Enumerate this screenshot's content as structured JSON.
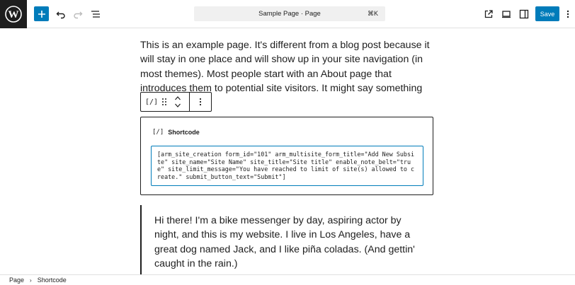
{
  "toolbar": {
    "command_title": "Sample Page · Page",
    "command_shortcut": "⌘K",
    "save_label": "Save"
  },
  "content": {
    "paragraph": "This is an example page. It's different from a blog post because it will stay in one place and will show up in your site navigation (in most themes). Most people start with an About page that introduces them to potential site visitors. It might say something",
    "shortcode_block": {
      "label": "Shortcode",
      "icon_text": "[/]",
      "value": "[arm_site_creation form_id=\"101\" arm_multisite_form_title=\"Add New Subsite\" site_name=\"Site Name\" site_title=\"Site title\" enable_note_belt=\"true\" site_limit_message=\"You have reached to limit of site(s) allowed to create.\" submit_button_text=\"Submit\"]"
    },
    "block_toolbar": {
      "icon_text": "[/]"
    },
    "quote": "Hi there! I'm a bike messenger by day, aspiring actor by night, and this is my website. I live in Los Angeles, have a great dog named Jack, and I like piña coladas. (And gettin' caught in the rain.)"
  },
  "breadcrumb": {
    "items": [
      "Page",
      "Shortcode"
    ],
    "separator": "›"
  },
  "colors": {
    "accent": "#007cba",
    "logo_bg": "#1e1e1e",
    "text": "#1e1e1e"
  }
}
